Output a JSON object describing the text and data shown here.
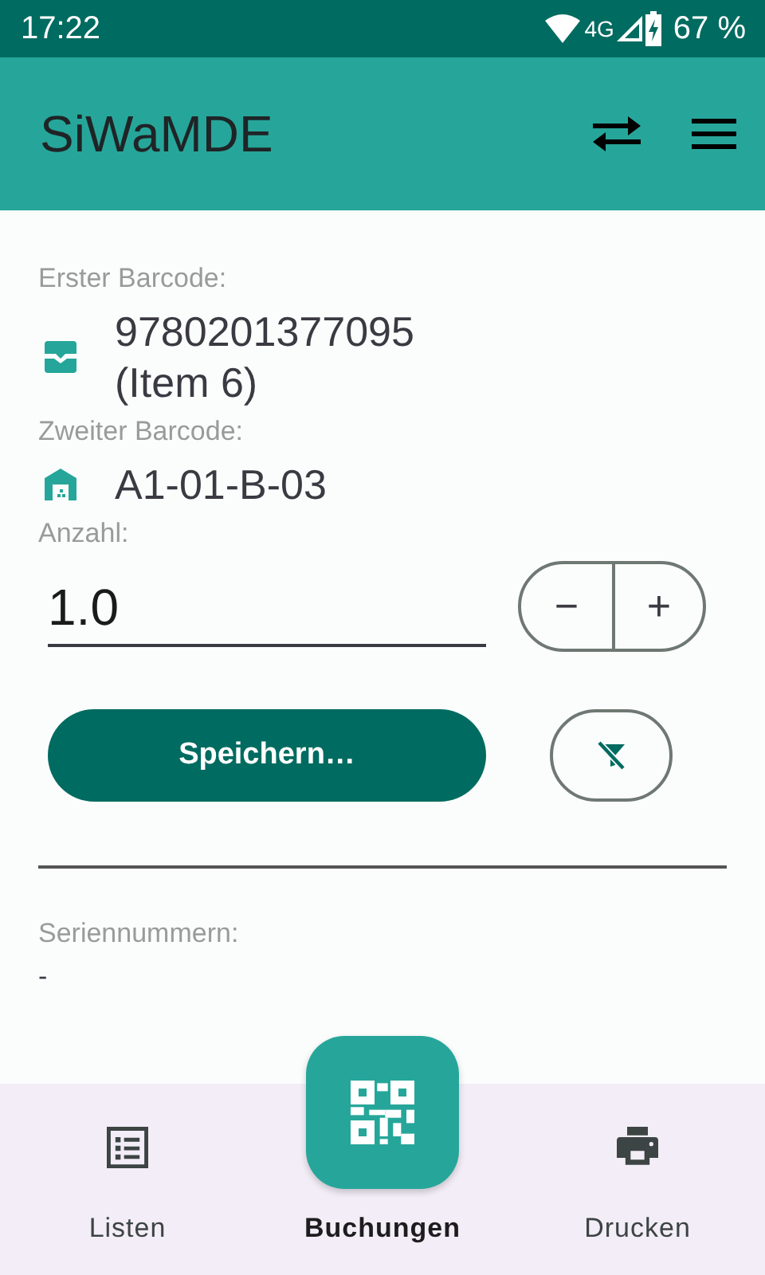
{
  "status_bar": {
    "time": "17:22",
    "network": "4G",
    "battery": "67 %"
  },
  "app_bar": {
    "title": "SiWaMDE"
  },
  "fields": [
    {
      "kind": "item",
      "label": "Erster Barcode:",
      "lines": [
        "9780201377095",
        "(Item 6)"
      ]
    },
    {
      "kind": "location",
      "label": "Zweiter Barcode:",
      "lines": [
        "A1-01-B-03"
      ]
    }
  ],
  "quantity": {
    "label": "Anzahl:",
    "value": "1.0",
    "decrement": "−",
    "increment": "+"
  },
  "save_button": "Speichern…",
  "serials": {
    "label": "Seriennummern:",
    "value": "-"
  },
  "bottom_nav": [
    {
      "kind": "list",
      "label": "Listen",
      "selected": false
    },
    {
      "kind": "qr",
      "label": "Buchungen",
      "selected": true
    },
    {
      "kind": "print",
      "label": "Drucken",
      "selected": false
    }
  ]
}
